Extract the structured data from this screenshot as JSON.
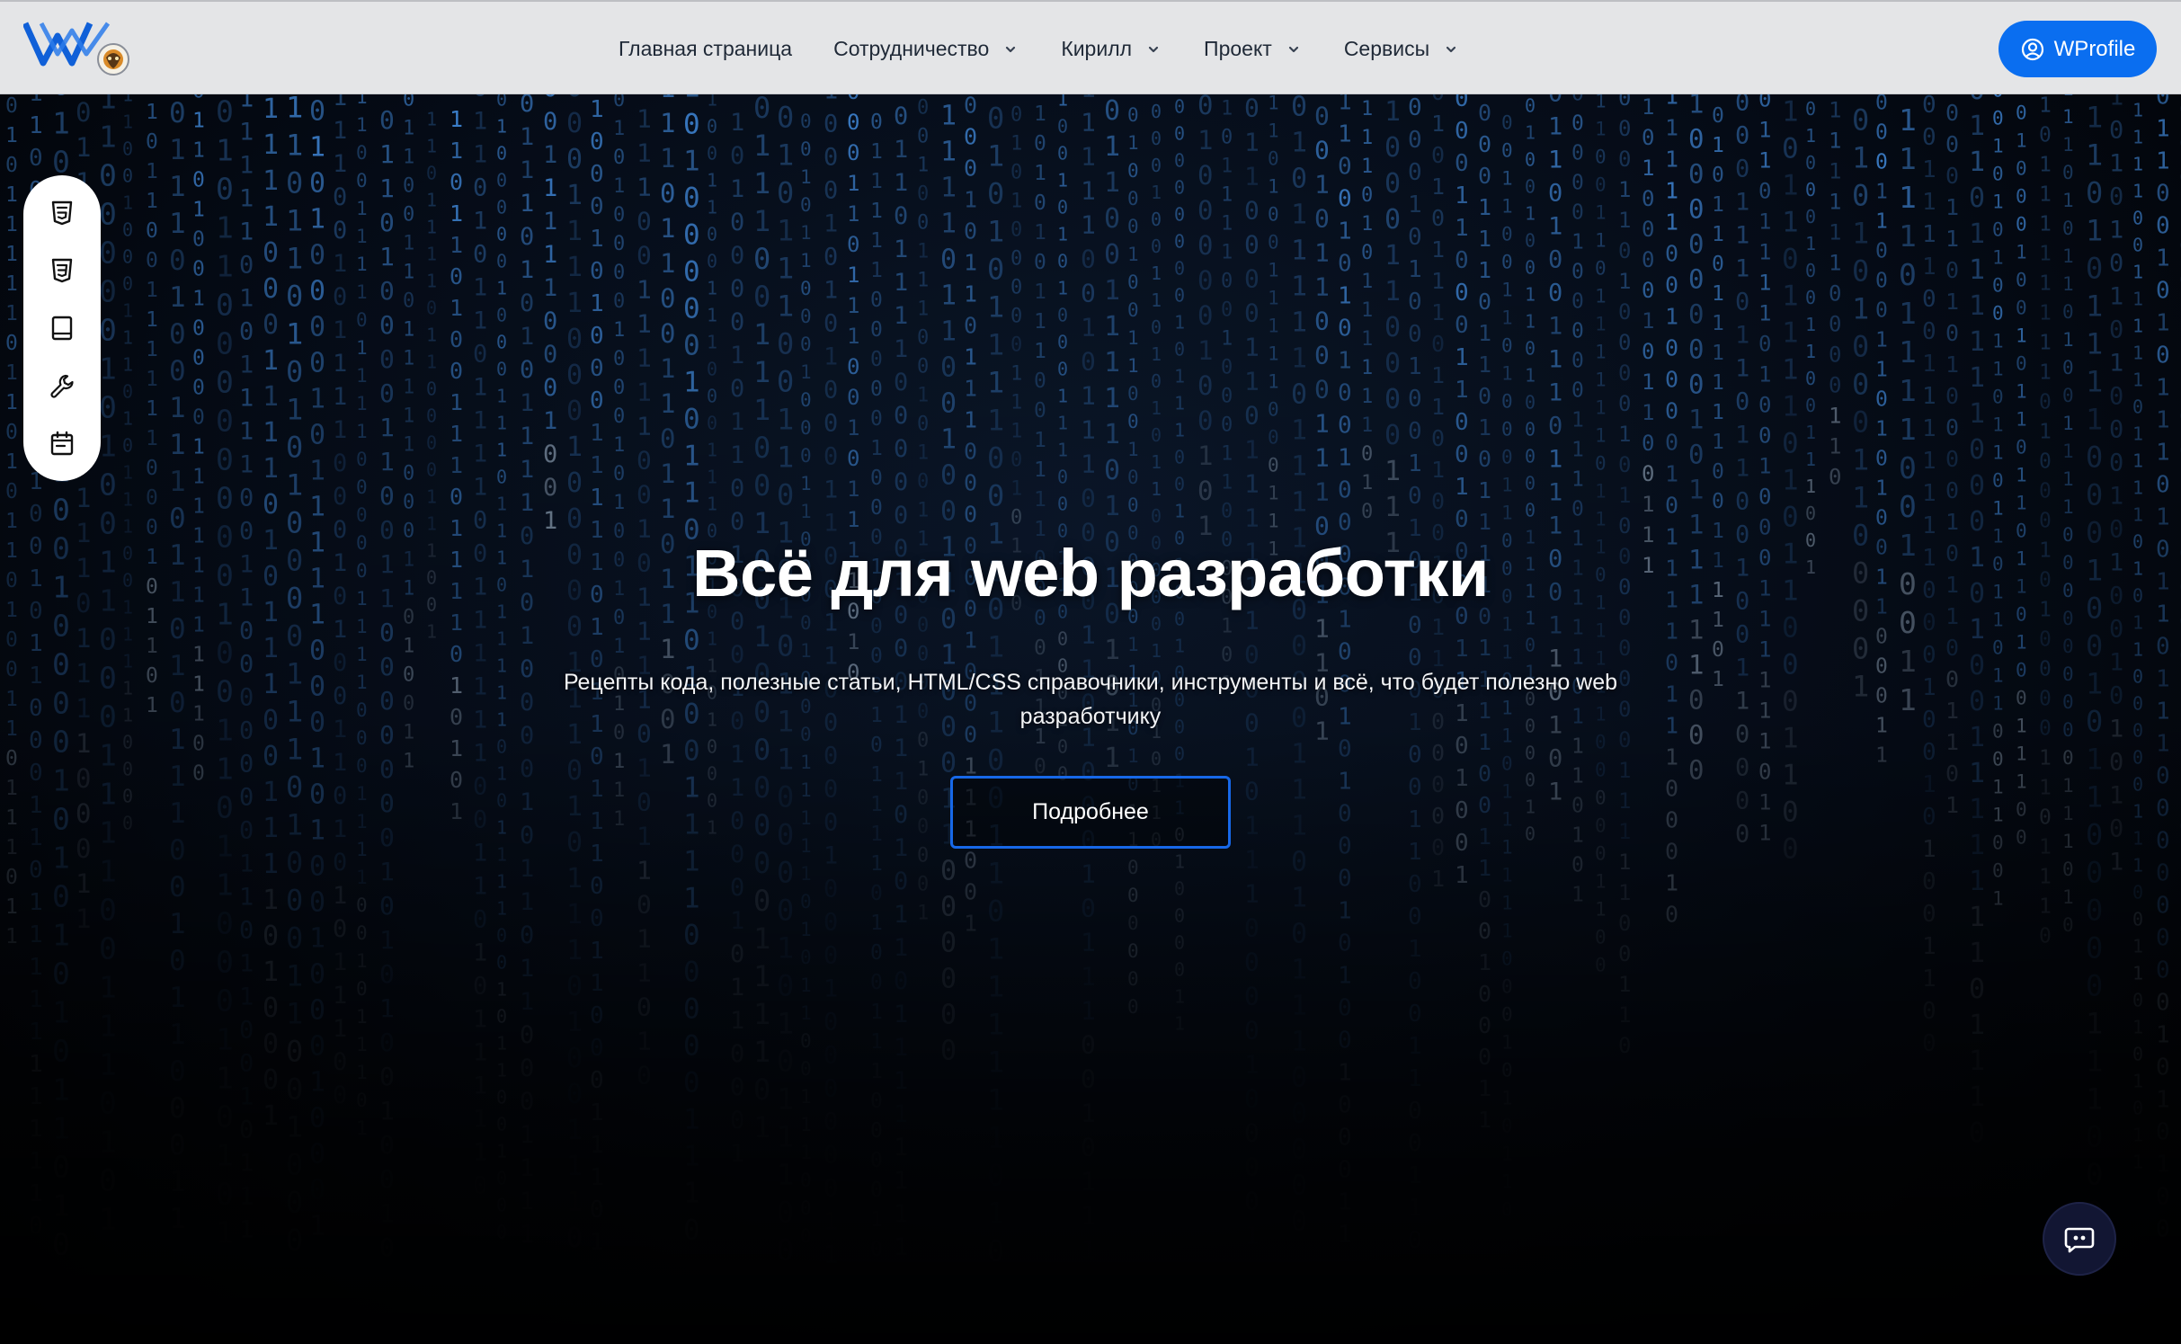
{
  "header": {
    "logo_alt": "W logo",
    "nav": [
      {
        "label": "Главная страница",
        "has_dropdown": false
      },
      {
        "label": "Сотрудничество",
        "has_dropdown": true
      },
      {
        "label": "Кирилл",
        "has_dropdown": true
      },
      {
        "label": "Проект",
        "has_dropdown": true
      },
      {
        "label": "Сервисы",
        "has_dropdown": true
      }
    ],
    "profile_label": "WProfile"
  },
  "hero": {
    "title": "Всё для web разработки",
    "subtitle": "Рецепты кода, полезные статьи, HTML/CSS справочники, инструменты и всё, что будет полезно web разработчику",
    "button_label": "Подробнее"
  },
  "side_toolbar": {
    "items": [
      {
        "icon": "html5-icon"
      },
      {
        "icon": "css3-icon"
      },
      {
        "icon": "book-icon"
      },
      {
        "icon": "wrench-icon"
      },
      {
        "icon": "calendar-icon"
      }
    ]
  },
  "chat": {
    "icon": "chat-bubble-icon"
  },
  "colors": {
    "header_bg": "#e4e5e7",
    "accent": "#0a6ef0",
    "button_border": "#1768e8",
    "chat_bg": "#121633",
    "matrix_blue": "#4a8fd8"
  }
}
